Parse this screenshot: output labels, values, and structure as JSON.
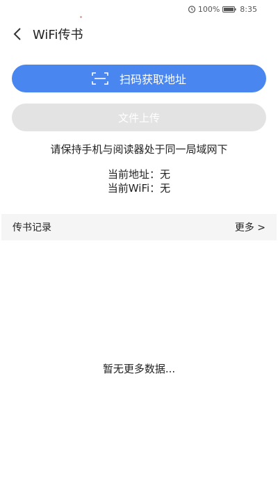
{
  "status_bar": {
    "battery_percent": "100%",
    "time": "8:35"
  },
  "header": {
    "title": "WiFi传书"
  },
  "actions": {
    "scan_label": "扫码获取地址",
    "upload_label": "文件上传"
  },
  "tip": "请保持手机与阅读器处于同一局域网下",
  "info": {
    "address_label": "当前地址：",
    "address_value": "无",
    "wifi_label": "当前WiFi：",
    "wifi_value": "无"
  },
  "records": {
    "title": "传书记录",
    "more_label": "更多 >",
    "empty_text": "暂无更多数据..."
  },
  "colors": {
    "primary": "#4a86f0",
    "disabled": "#e3e3e3",
    "section_bg": "#f5f5f5"
  }
}
